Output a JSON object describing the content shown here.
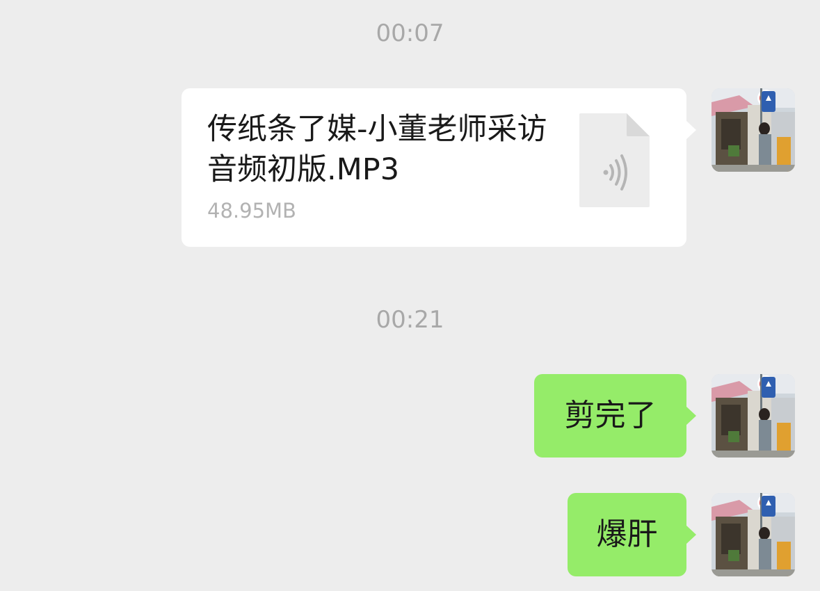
{
  "messages": [
    {
      "timestamp": "00:07",
      "type": "file",
      "file_name": "传纸条了媒-小董老师采访音频初版.MP3",
      "file_size": "48.95MB",
      "file_icon": "audio-file-icon"
    },
    {
      "timestamp": "00:21",
      "type": "text",
      "text": "剪完了"
    },
    {
      "type": "text",
      "text": "爆肝"
    }
  ],
  "colors": {
    "background": "#ededed",
    "sent_bubble": "#95ec69",
    "file_bubble": "#ffffff",
    "timestamp_text": "#a8a8a8",
    "file_size_text": "#b2b2b2"
  }
}
